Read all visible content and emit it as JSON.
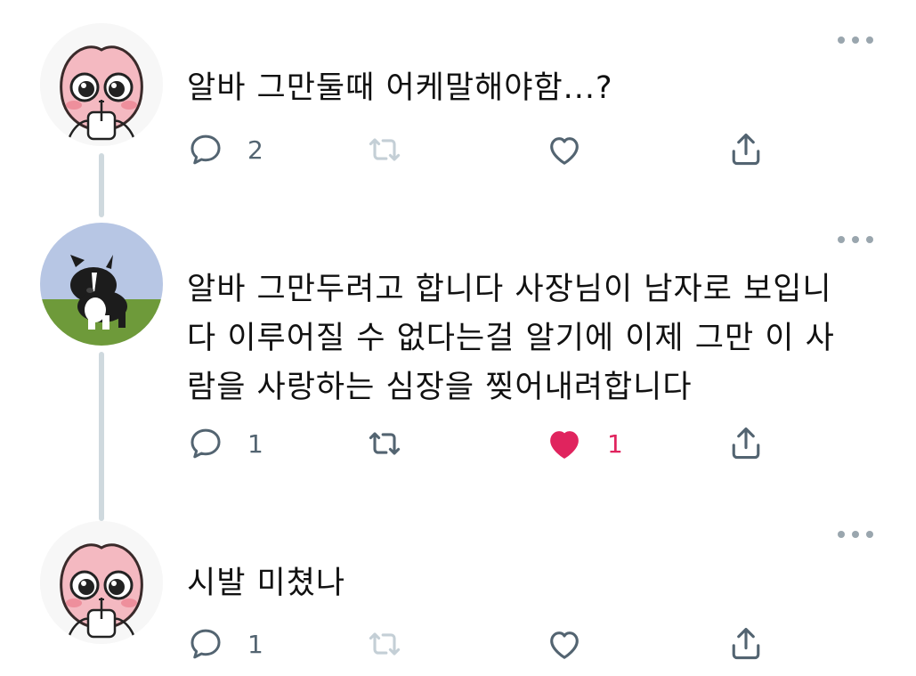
{
  "tweets": [
    {
      "text": "알바 그만둘때 어케말해야함...?",
      "reply_count": "2",
      "retweet_count": "",
      "like_count": "",
      "liked": false,
      "avatar": "peach-character-avatar"
    },
    {
      "text": "알바 그만두려고 합니다 사장님이 남자로 보입니\n다 이루어질 수 없다는걸 알기에 이제 그만 이 사\n람을 사랑하는 심장을 찢어내려합니다",
      "reply_count": "1",
      "retweet_count": "",
      "like_count": "1",
      "liked": true,
      "avatar": "border-collie-plush-avatar"
    },
    {
      "text": "시발 미쳤나",
      "reply_count": "1",
      "retweet_count": "",
      "like_count": "",
      "liked": false,
      "avatar": "peach-character-avatar"
    }
  ],
  "icons": {
    "reply": "reply-icon",
    "retweet": "retweet-icon",
    "like": "heart-icon",
    "share": "share-icon",
    "more": "more-icon"
  },
  "colors": {
    "icon_gray": "#536471",
    "like_red": "#e0245e",
    "thread_line": "#cfd9de"
  }
}
